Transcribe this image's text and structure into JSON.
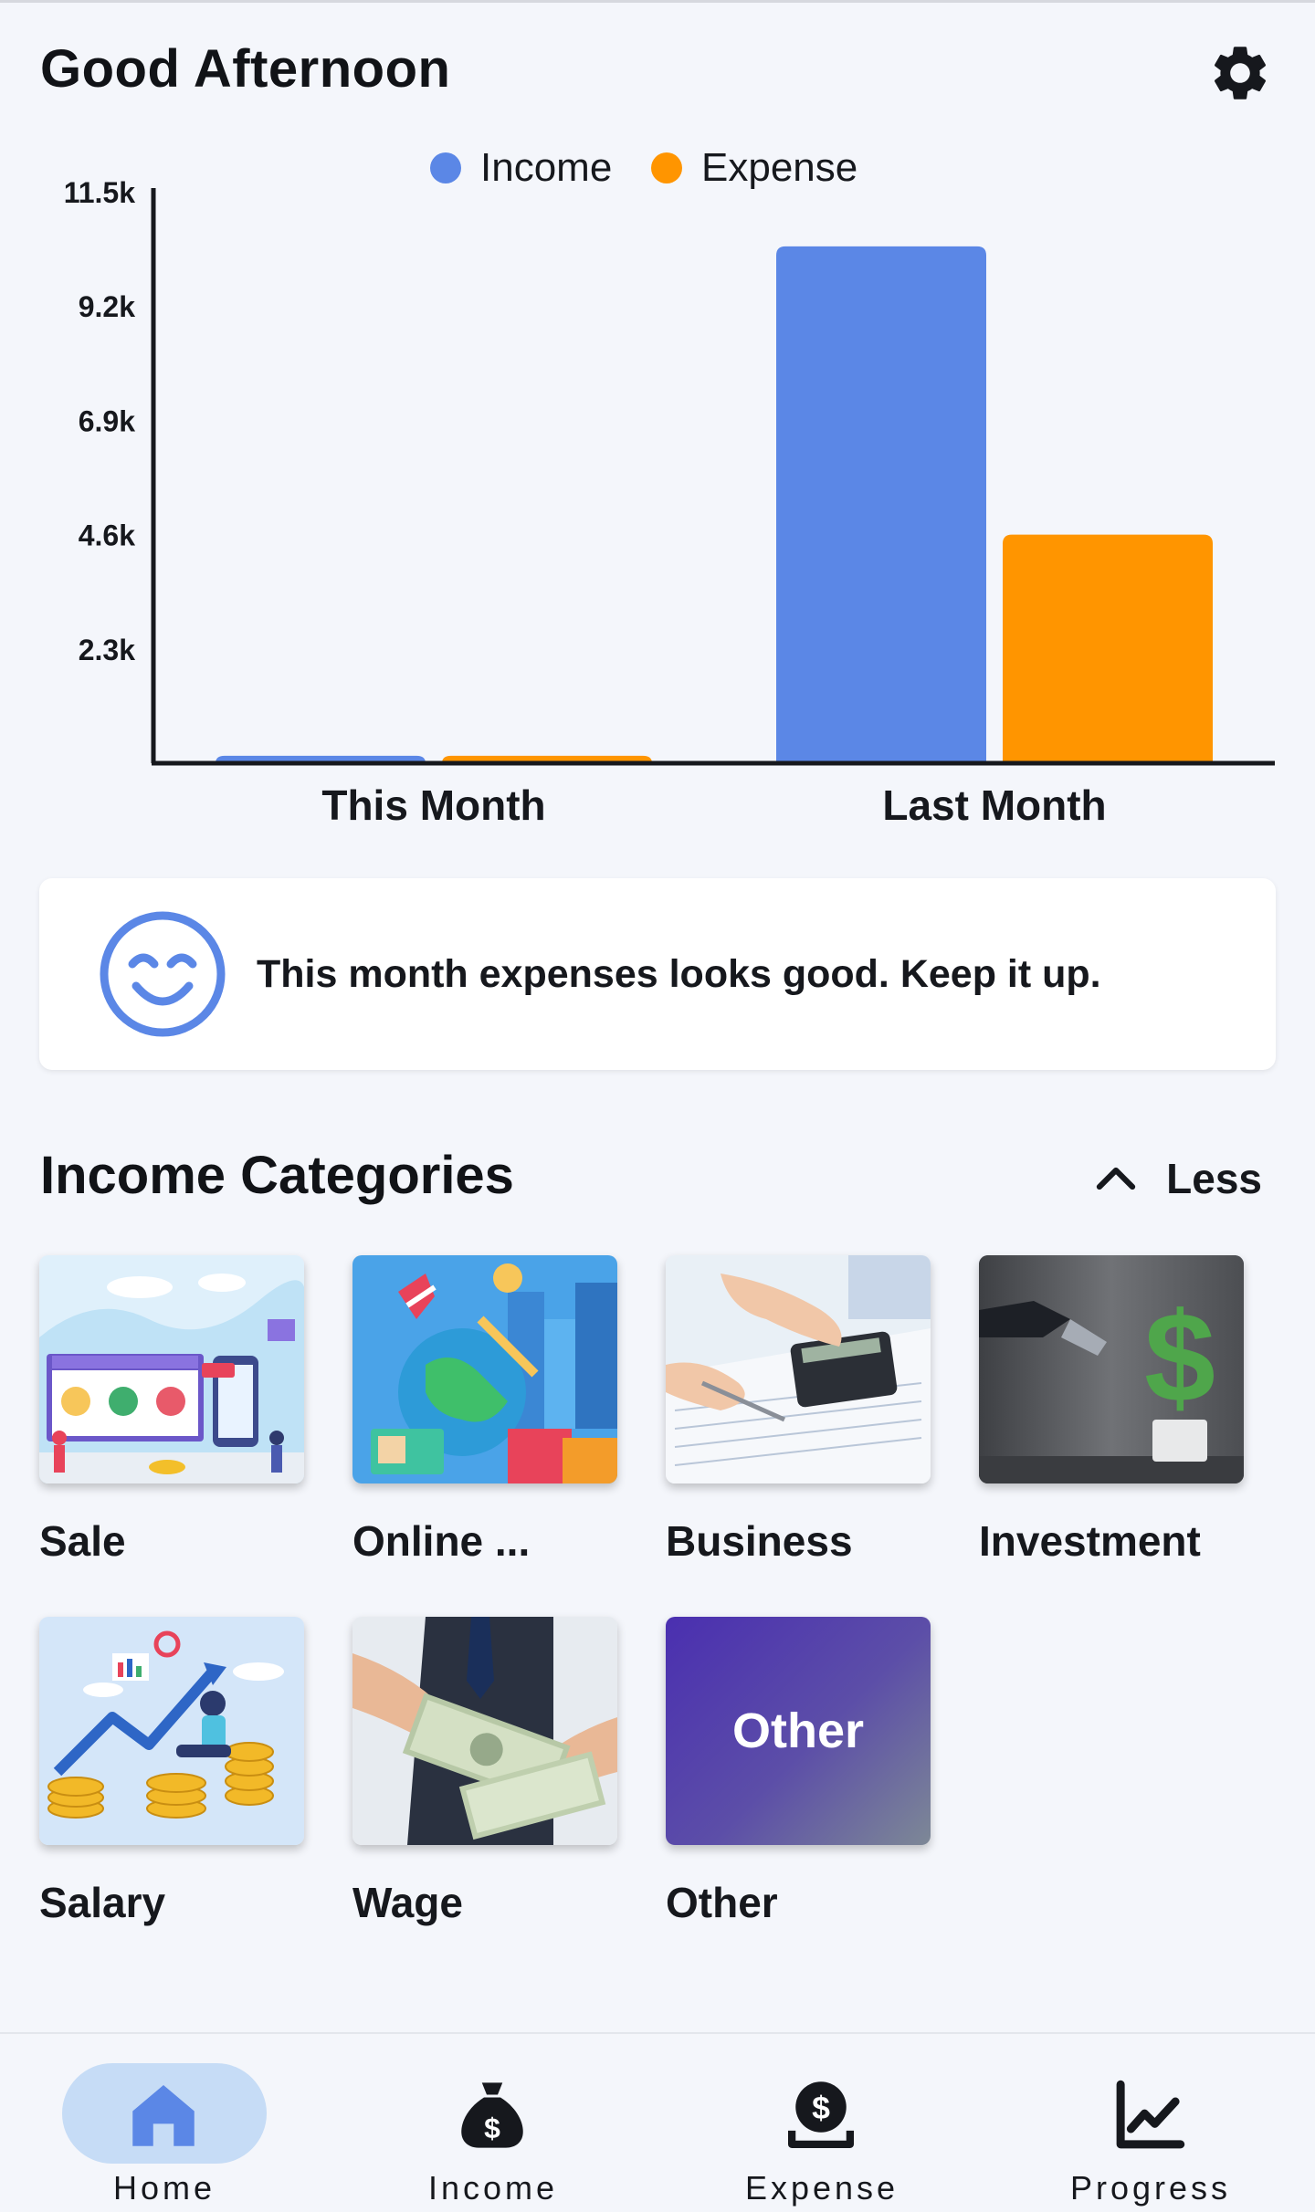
{
  "header": {
    "greeting": "Good Afternoon",
    "settings_icon": "gear-icon"
  },
  "chart_data": {
    "type": "bar",
    "categories": [
      "This Month",
      "Last Month"
    ],
    "series": [
      {
        "name": "Income",
        "values": [
          150,
          10400
        ],
        "color": "#5b87e6"
      },
      {
        "name": "Expense",
        "values": [
          150,
          4600
        ],
        "color": "#ff9500"
      }
    ],
    "yticks": [
      2.3,
      4.6,
      6.9,
      9.2,
      11.5
    ],
    "ytick_labels": [
      "2.3k",
      "4.6k",
      "6.9k",
      "9.2k",
      "11.5k"
    ],
    "ylim": [
      0,
      11500
    ],
    "legend_position": "top-center",
    "grid": false
  },
  "insight": {
    "icon": "smiley-icon",
    "message": "This month expenses looks good. Keep it up."
  },
  "income_section": {
    "title": "Income Categories",
    "toggle_label": "Less",
    "toggle_icon": "chevron-up-icon",
    "categories": [
      {
        "label": "Sale",
        "image": "online-shopping-illustration"
      },
      {
        "label": "Online ...",
        "image": "online-world-illustration"
      },
      {
        "label": "Business",
        "image": "calculator-photo"
      },
      {
        "label": "Investment",
        "image": "dollar-plant-photo"
      },
      {
        "label": "Salary",
        "image": "coins-growth-illustration"
      },
      {
        "label": "Wage",
        "image": "cash-handover-photo"
      },
      {
        "label": "Other",
        "tile_text": "Other"
      }
    ]
  },
  "nav": {
    "items": [
      {
        "label": "Home",
        "icon": "home-icon",
        "active": true
      },
      {
        "label": "Income",
        "icon": "money-bag-icon"
      },
      {
        "label": "Expense",
        "icon": "dollar-coin-icon"
      },
      {
        "label": "Progress",
        "icon": "trending-chart-icon"
      }
    ]
  },
  "colors": {
    "accent": "#5b87e6",
    "expense": "#ff9500",
    "nav_active_pill": "#c6dcf6",
    "background": "#f4f6fb"
  }
}
